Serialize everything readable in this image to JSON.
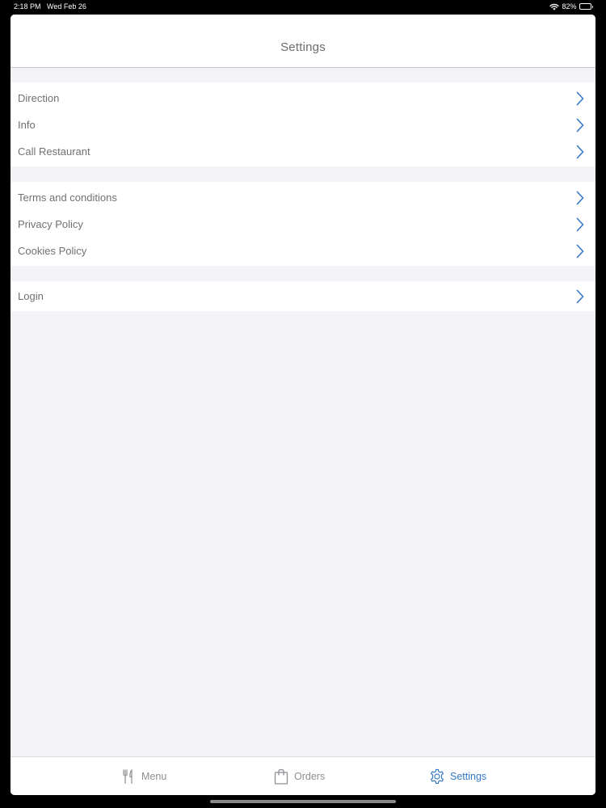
{
  "status_bar": {
    "time": "2:18 PM",
    "date": "Wed Feb 26",
    "battery": "82%",
    "battery_level": 0.82
  },
  "nav": {
    "title": "Settings"
  },
  "groups": [
    {
      "items": [
        {
          "label": "Direction"
        },
        {
          "label": "Info"
        },
        {
          "label": "Call Restaurant"
        }
      ]
    },
    {
      "items": [
        {
          "label": "Terms and conditions"
        },
        {
          "label": "Privacy Policy"
        },
        {
          "label": "Cookies Policy"
        }
      ]
    },
    {
      "items": [
        {
          "label": "Login"
        }
      ]
    }
  ],
  "tab_bar": {
    "tabs": [
      {
        "label": "Menu",
        "icon": "fork-knife-icon",
        "active": false
      },
      {
        "label": "Orders",
        "icon": "shopping-bag-icon",
        "active": false
      },
      {
        "label": "Settings",
        "icon": "gear-icon",
        "active": true
      }
    ]
  },
  "colors": {
    "accent": "#3478c6",
    "background": "#f3f2f7",
    "text": "#707075",
    "inactive_tab": "#8e8e93"
  }
}
